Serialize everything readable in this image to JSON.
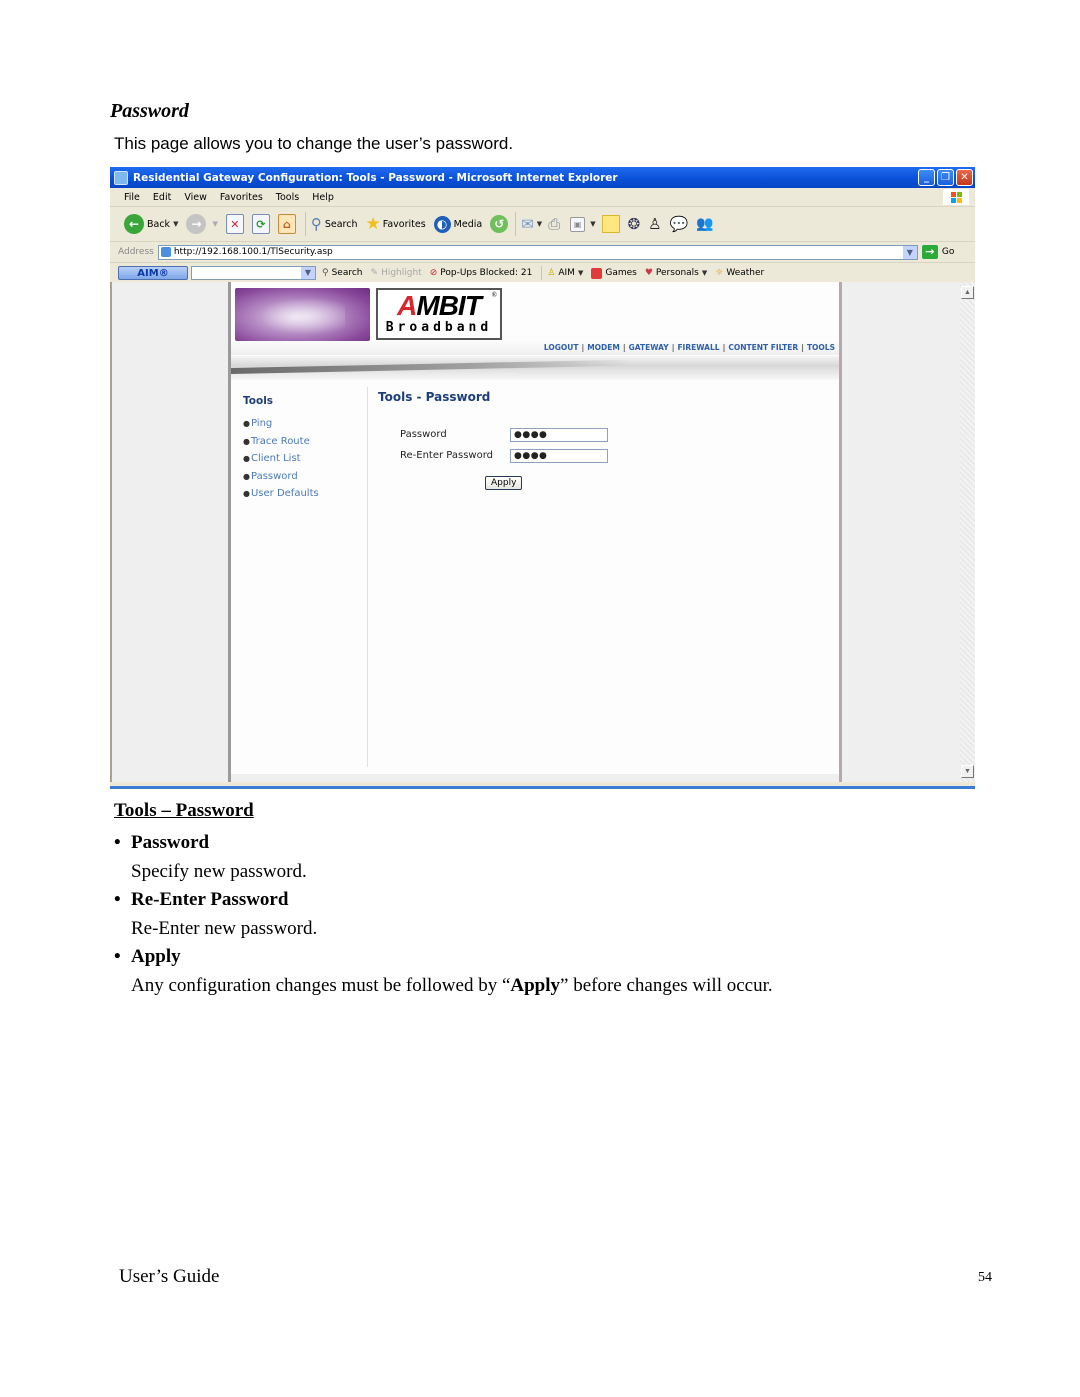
{
  "document": {
    "heading": "Password",
    "intro": "This page allows you to change the user’s password."
  },
  "browser": {
    "title": "Residential Gateway Configuration: Tools - Password - Microsoft Internet Explorer",
    "window_buttons": {
      "minimize": "_",
      "restore": "❐",
      "close": "✕"
    },
    "menu": [
      "File",
      "Edit",
      "View",
      "Favorites",
      "Tools",
      "Help"
    ],
    "toolbar": {
      "back": "Back",
      "search": "Search",
      "favorites": "Favorites",
      "media": "Media"
    },
    "address": {
      "label": "Address",
      "url": "http://192.168.100.1/TlSecurity.asp",
      "go": "Go"
    },
    "aim_toolbar": {
      "logo": "AIM®",
      "search_value": "",
      "items": [
        "Search",
        "Highlight",
        "Pop-Ups Blocked: 21",
        "AIM",
        "Games",
        "Personals",
        "Weather"
      ]
    }
  },
  "router_page": {
    "brand": "AMBIT",
    "brand_sub": "Broadband",
    "nav_links": [
      "LOGOUT",
      "MODEM",
      "GATEWAY",
      "FIREWALL",
      "CONTENT FILTER",
      "TOOLS"
    ],
    "side_nav": {
      "title": "Tools",
      "items": [
        "Ping",
        "Trace Route",
        "Client List",
        "Password",
        "User Defaults"
      ]
    },
    "form": {
      "title": "Tools - Password",
      "password_label": "Password",
      "password_value": "●●●●",
      "reenter_label": "Re-Enter Password",
      "reenter_value": "●●●●",
      "apply": "Apply"
    }
  },
  "section": {
    "title": "Tools – Password",
    "items": [
      {
        "label": "Password",
        "desc": "Specify new password."
      },
      {
        "label": "Re-Enter Password",
        "desc": "Re-Enter new password."
      },
      {
        "label": "Apply",
        "desc_pre": "Any configuration changes must be followed by “",
        "desc_bold": "Apply",
        "desc_post": "” before changes will occur."
      }
    ]
  },
  "footer": {
    "guide": "User’s Guide",
    "page_number": "54"
  }
}
